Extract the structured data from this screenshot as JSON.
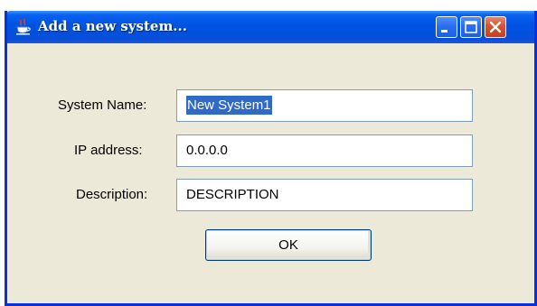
{
  "window": {
    "title": "Add a new system...",
    "icon": "java-cup-icon"
  },
  "titlebar_buttons": {
    "minimize_icon": "minimize-icon",
    "maximize_icon": "maximize-icon",
    "close_icon": "close-icon"
  },
  "form": {
    "fields": [
      {
        "label": "System Name:",
        "value": "New System1",
        "selected": true
      },
      {
        "label": "IP address:",
        "value": "0.0.0.0",
        "selected": false
      },
      {
        "label": "Description:",
        "value": "DESCRIPTION",
        "selected": false
      }
    ],
    "ok_label": "OK"
  },
  "colors": {
    "titlebar": "#0054e3",
    "dialog_background": "#ece9d8",
    "selection": "#316ac5",
    "close_button": "#d8512f"
  }
}
